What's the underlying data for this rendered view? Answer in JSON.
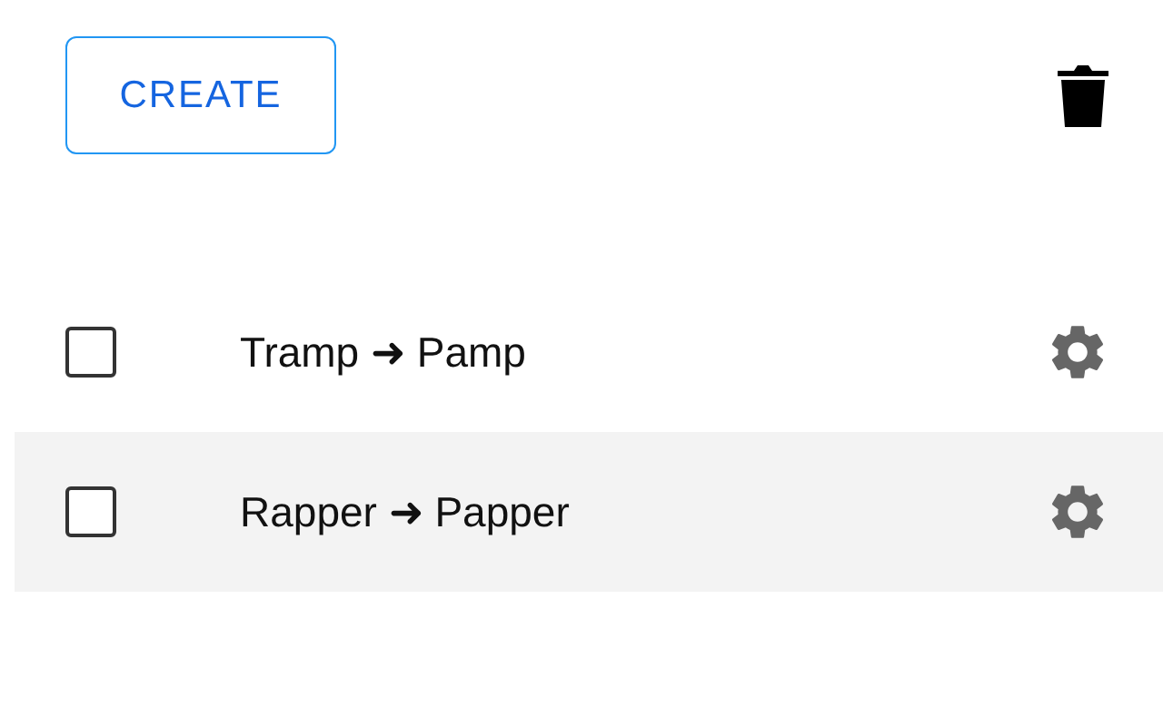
{
  "toolbar": {
    "create_button": "CREATE"
  },
  "rows": [
    {
      "label": "Tramp ➜ Pamp",
      "checked": false,
      "highlighted": false
    },
    {
      "label": "Rapper ➜ Papper",
      "checked": false,
      "highlighted": true
    }
  ]
}
